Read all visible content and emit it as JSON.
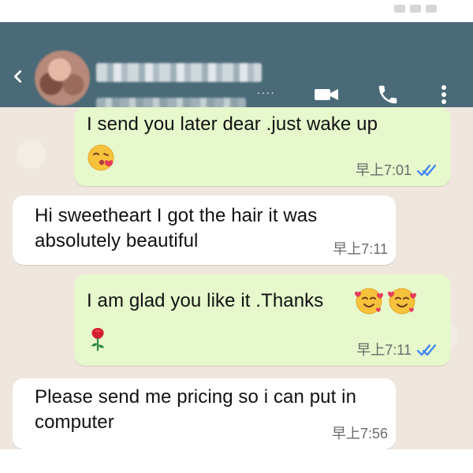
{
  "header": {
    "contact_name": "",
    "contact_status": "",
    "ellipsis": "...."
  },
  "messages": [
    {
      "direction": "outgoing",
      "text": "I send you later dear .just wake up",
      "emoji": [
        "kissing-wink-heart"
      ],
      "time": "早上7:01",
      "read_receipt": "double-check-blue"
    },
    {
      "direction": "incoming",
      "text": "Hi sweetheart I got the hair it was absolutely beautiful",
      "time": "早上7:11"
    },
    {
      "direction": "outgoing",
      "text": "I am glad you like it .Thanks",
      "emoji": [
        "smiling-face-with-hearts",
        "smiling-face-with-hearts",
        "rose"
      ],
      "time": "早上7:11",
      "read_receipt": "double-check-blue"
    },
    {
      "direction": "incoming",
      "text": "Please send me pricing so i can put in computer",
      "time": "早上7:56"
    }
  ],
  "colors": {
    "app_bar": "#4a6a78",
    "chat_bg": "#efe7de",
    "outgoing_bubble": "#e6f8cc",
    "incoming_bubble": "#ffffff",
    "read_tick": "#3b82f6"
  },
  "icons": {
    "back": "chevron-left-icon",
    "video": "video-camera-icon",
    "call": "phone-icon",
    "menu": "kebab-menu-icon",
    "read_receipt": "double-check-icon"
  }
}
